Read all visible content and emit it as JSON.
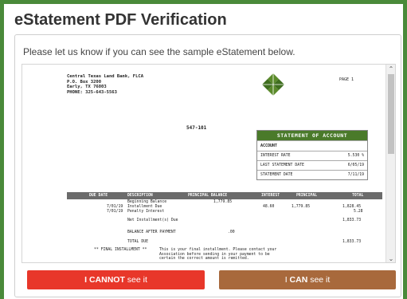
{
  "header": {
    "title": "eStatement PDF Verification"
  },
  "prompt": "Please let us know if you can see the sample eStatement below.",
  "statement": {
    "bank_name": "Central Texas Land Bank, FLCA",
    "address1": "P.O. Box 3200",
    "address2": "Early, TX 76803",
    "phone": "PHONE:    325-643-5563",
    "page_label": "PAGE 1",
    "account_number": "547-101",
    "soa": {
      "title": "STATEMENT OF ACCOUNT",
      "account_label": "ACCOUNT",
      "rows": [
        {
          "label": "INTEREST RATE",
          "value": "5.530 %"
        },
        {
          "label": "LAST STATEMENT DATE",
          "value": "6/05/19"
        },
        {
          "label": "STATEMENT DATE",
          "value": "7/11/19"
        }
      ]
    },
    "columns": {
      "due_date": "DUE DATE",
      "description": "DESCRIPTION",
      "principal_balance": "PRINCIPAL BALANCE",
      "interest": "INTEREST",
      "principal": "PRINCIPAL",
      "total": "TOTAL"
    },
    "lines": {
      "beginning_desc": "Beginning Balance",
      "beginning_bal": "1,779.85",
      "inst_date": "7/01/19",
      "inst_desc": "Installment Due",
      "inst_interest": "48.60",
      "inst_principal": "1,779.85",
      "inst_total": "1,828.45",
      "pen_date": "7/01/19",
      "pen_desc": "Penalty Interest",
      "pen_total": "5.28",
      "net_desc": "Net Installment(s) Due",
      "net_total": "1,833.73",
      "after_desc": "BALANCE AFTER PAYMENT",
      "after_bal": ".00",
      "total_desc": "TOTAL DUE",
      "total_total": "1,833.73",
      "final_label": "** FINAL INSTALLMENT **",
      "final_text1": "This is your final installment.  Please contact your",
      "final_text2": "Association before sending in your payment to be",
      "final_text3": "certain the correct amount is remitted."
    }
  },
  "buttons": {
    "cannot_strong": "I CANNOT",
    "cannot_rest": " see it",
    "can_pre": "I ",
    "can_strong": "CAN",
    "can_rest": " see it"
  },
  "colors": {
    "cannot": "#e8372a",
    "can": "#a8693c",
    "brand": "#4a7a2a"
  }
}
